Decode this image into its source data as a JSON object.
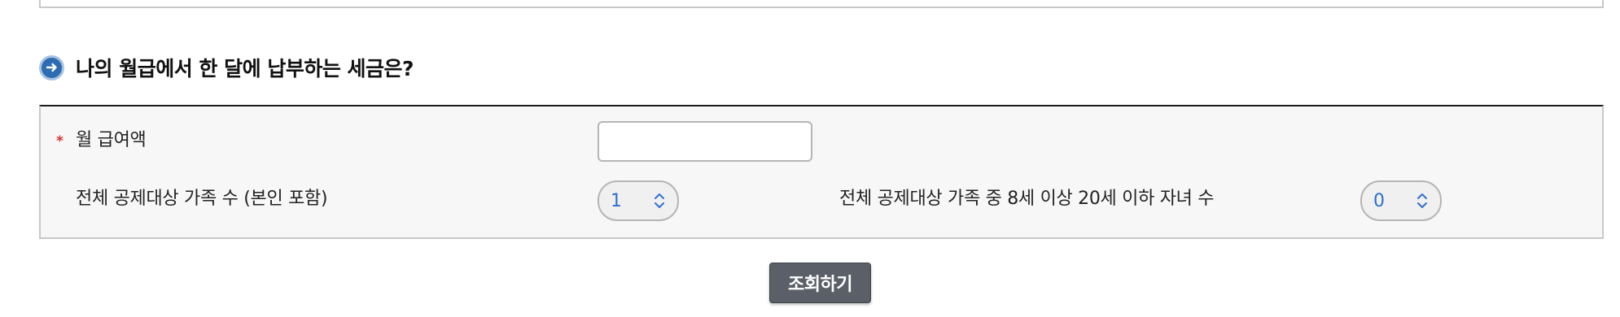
{
  "section": {
    "title": "나의 월급에서 한 달에 납부하는 세금은?",
    "icon": "arrow-right-circle-icon",
    "icon_color": "#2d6cb0"
  },
  "form": {
    "salary": {
      "required_marker": "*",
      "label": "월 급여액",
      "value": "",
      "placeholder": ""
    },
    "family_count": {
      "label": "전체 공제대상 가족 수 (본인 포함)",
      "value": "1"
    },
    "children_count": {
      "label": "전체 공제대상 가족 중 8세 이상 20세 이하 자녀 수",
      "value": "0"
    }
  },
  "actions": {
    "submit_label": "조회하기"
  },
  "colors": {
    "accent": "#2d6cb0",
    "required": "#d9302c",
    "stepper_value": "#2f6fd1",
    "button_bg": "#5b6068"
  }
}
